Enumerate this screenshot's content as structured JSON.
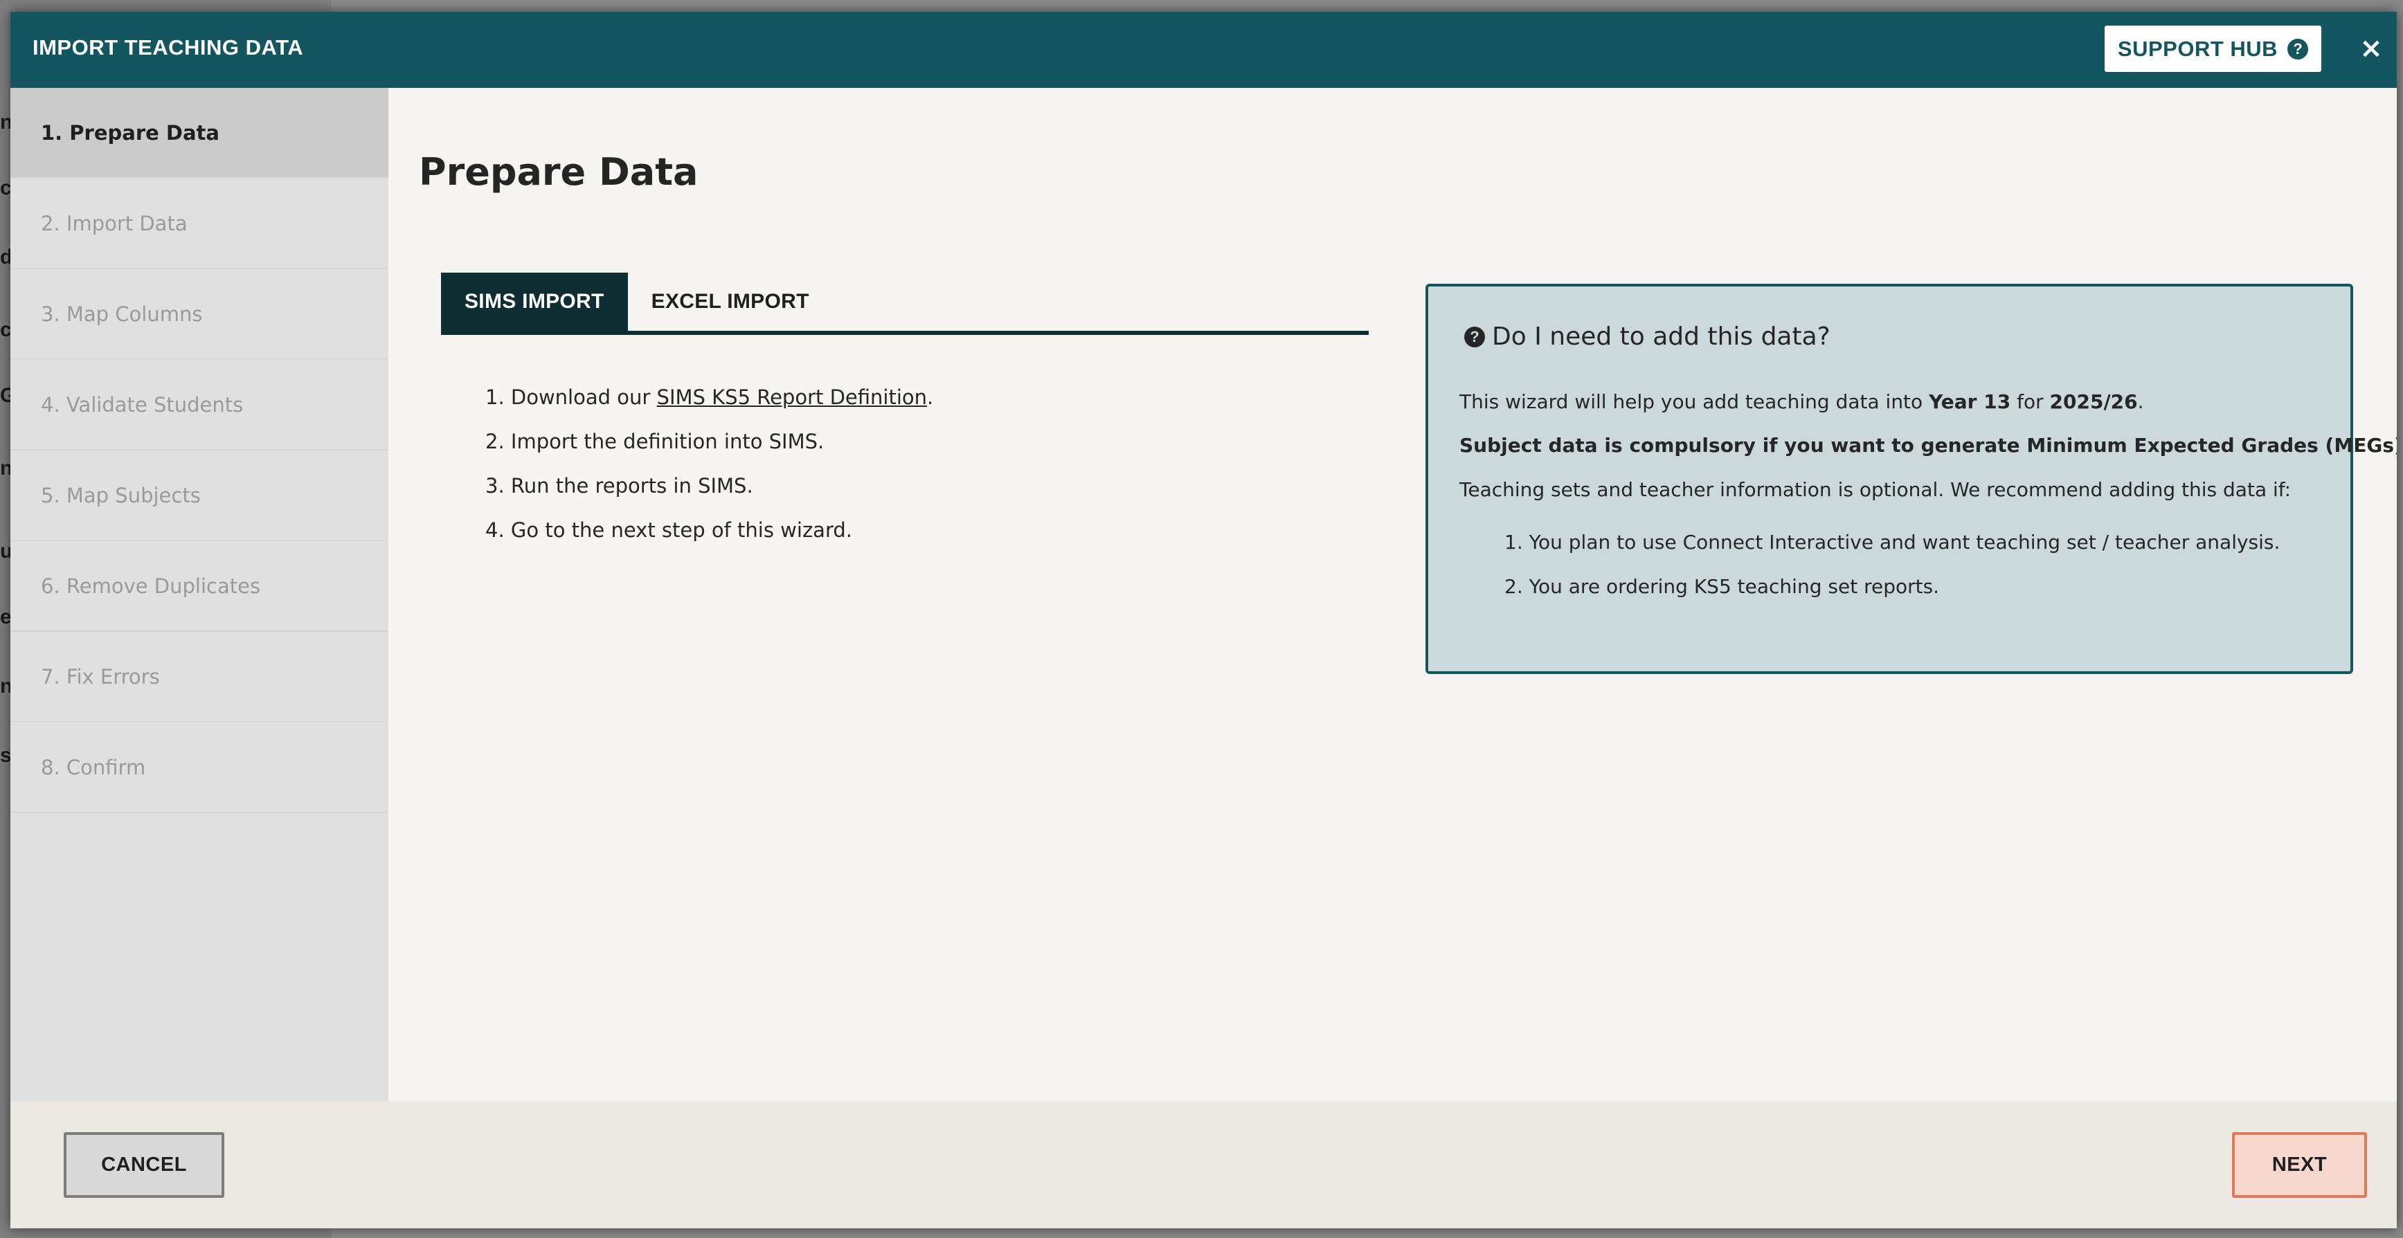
{
  "backdrop": {
    "fragments": [
      "n",
      "c",
      "d",
      "c",
      "G",
      "n",
      "u",
      "e",
      "n",
      "st"
    ]
  },
  "modal": {
    "title": "IMPORT TEACHING DATA",
    "support_label": "SUPPORT HUB",
    "support_icon": "question-circle-icon",
    "close_symbol": "×"
  },
  "sidebar": {
    "items": [
      {
        "label": "1. Prepare Data",
        "active": true
      },
      {
        "label": "2. Import Data",
        "active": false
      },
      {
        "label": "3. Map Columns",
        "active": false
      },
      {
        "label": "4. Validate Students",
        "active": false
      },
      {
        "label": "5. Map Subjects",
        "active": false
      },
      {
        "label": "6. Remove Duplicates",
        "active": false
      },
      {
        "label": "7. Fix Errors",
        "active": false
      },
      {
        "label": "8. Confirm",
        "active": false
      }
    ]
  },
  "main": {
    "title": "Prepare Data",
    "tabs": [
      {
        "label": "SIMS IMPORT",
        "active": true
      },
      {
        "label": "EXCEL IMPORT",
        "active": false
      }
    ],
    "steps": {
      "s1_prefix": "1. Download our ",
      "s1_link": "SIMS KS5 Report Definition",
      "s1_suffix": ".",
      "s2": "2. Import the definition into SIMS.",
      "s3": "3. Run the reports in SIMS.",
      "s4": "4. Go to the next step of this wizard."
    }
  },
  "info": {
    "heading": "Do I need to add this data?",
    "line1_prefix": "This wizard will help you add teaching data into ",
    "line1_year": "Year 13",
    "line1_mid": " for ",
    "line1_period": "2025/26",
    "line1_suffix": ".",
    "line2": "Subject data is compulsory if you want to generate Minimum Expected Grades (MEGs)",
    "line3": "Teaching sets and teacher information is optional. We recommend adding this data if:",
    "items": [
      "1. You plan to use Connect Interactive and want teaching set / teacher analysis.",
      "2. You are ordering KS5 teaching set reports."
    ]
  },
  "footer": {
    "cancel_label": "CANCEL",
    "next_label": "NEXT"
  },
  "colors": {
    "header": "#13565f",
    "tab_active": "#0e2e33",
    "info_bg": "#cbd9da",
    "next_border": "#e0785a",
    "next_bg": "#f6d7cc"
  }
}
